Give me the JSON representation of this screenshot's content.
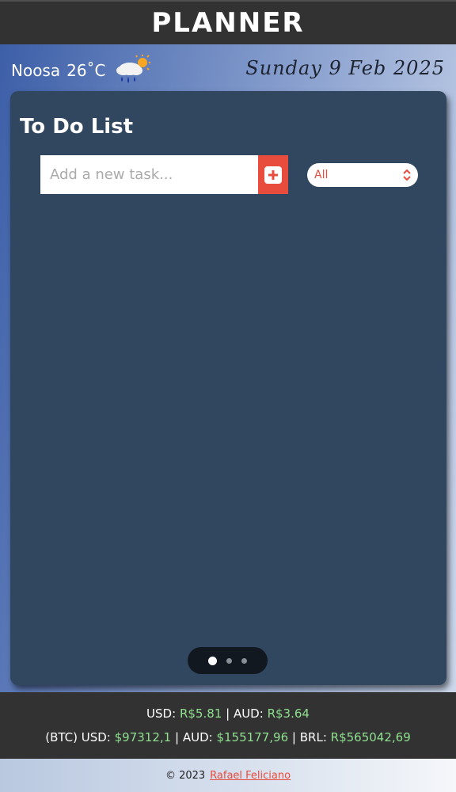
{
  "app": {
    "title": "PLANNER"
  },
  "weather": {
    "location": "Noosa",
    "temperature": "26˚C",
    "icon": "rain-sun-cloud-icon"
  },
  "date": "Sunday 9 Feb 2025",
  "todo": {
    "title": "To Do List",
    "input_placeholder": "Add a new task...",
    "add_icon": "plus-square-icon",
    "filter_value": "All",
    "tasks": []
  },
  "pager": {
    "pages": 3,
    "active": 1
  },
  "rates": {
    "fiat": {
      "usd_label": "USD:",
      "usd_value": "R$5.81",
      "sep": "|",
      "aud_label": "AUD:",
      "aud_value": "R$3.64"
    },
    "btc": {
      "prefix": "(BTC) USD:",
      "usd_value": "$97312,1",
      "aud_label": "AUD:",
      "aud_value": "$155177,96",
      "brl_label": "BRL:",
      "brl_value": "R$565042,69"
    }
  },
  "footer": {
    "copyright": "© 2023",
    "author": "Rafael Feliciano"
  },
  "colors": {
    "accent": "#e74c3c",
    "card": "#31475f",
    "rate_value": "#8fe08f"
  }
}
